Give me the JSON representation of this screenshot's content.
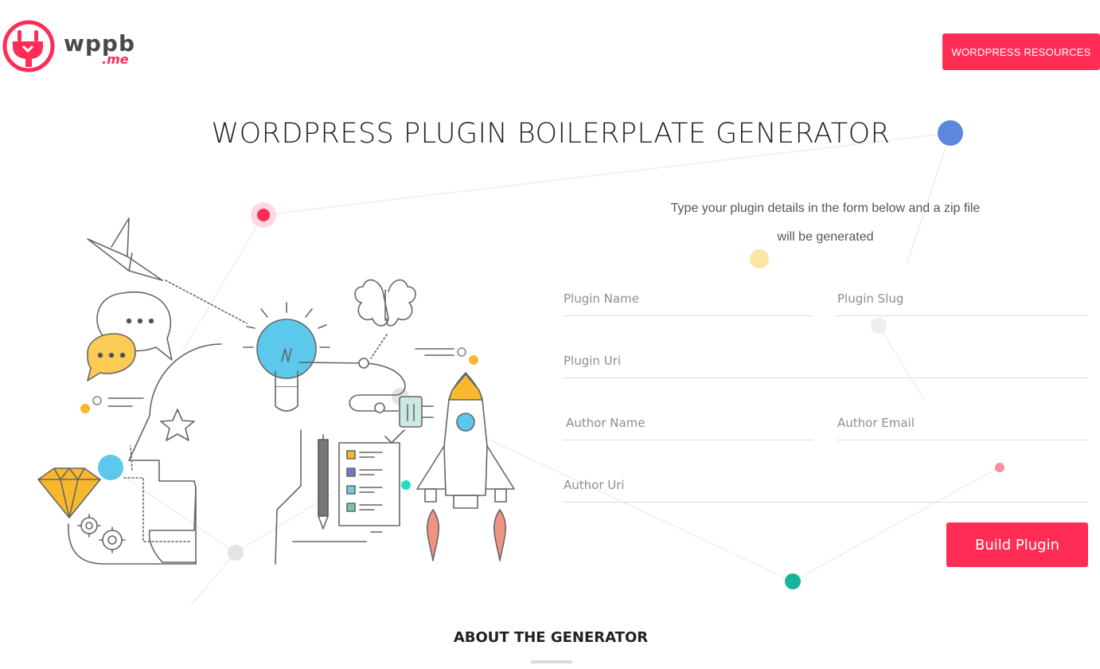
{
  "logo": {
    "word": "wppb",
    "sub": ".me"
  },
  "header": {
    "resources_label": "WORDPRESS RESOURCES"
  },
  "page": {
    "title": "WORDPRESS PLUGIN BOILERPLATE GENERATOR"
  },
  "form": {
    "intro": "Type your plugin details in the form below and a zip file will be generated",
    "fields": {
      "plugin_name": "Plugin Name",
      "plugin_slug": "Plugin Slug",
      "plugin_uri": "Plugin Uri",
      "author_name": "Author Name",
      "author_email": "Author Email",
      "author_uri": "Author Uri"
    },
    "build_label": "Build Plugin"
  },
  "about": {
    "title": "ABOUT THE GENERATOR"
  },
  "colors": {
    "accent": "#ff2d55",
    "blue_dot": "#5b87dd",
    "yellow": "#f8b82e",
    "cyan": "#5bc8ec",
    "teal": "#16b59a",
    "salmon": "#f29482"
  },
  "icons": [
    "plug-logo-icon",
    "lightbulb-icon",
    "brain-icon",
    "rocket-icon",
    "diamond-icon",
    "gears-icon",
    "paper-bird-icon",
    "chat-bubbles-icon",
    "star-icon",
    "pen-icon",
    "checklist-icon",
    "power-plug-icon"
  ]
}
